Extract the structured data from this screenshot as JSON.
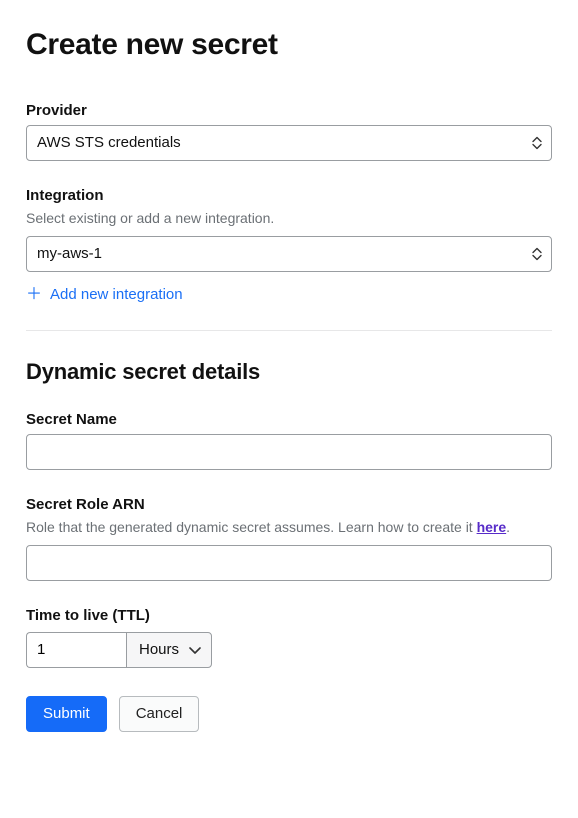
{
  "page": {
    "title": "Create new secret"
  },
  "provider": {
    "label": "Provider",
    "value": "AWS STS credentials"
  },
  "integration": {
    "label": "Integration",
    "hint": "Select existing or add a new integration.",
    "value": "my-aws-1",
    "add_label": "Add new integration"
  },
  "section": {
    "title": "Dynamic secret details"
  },
  "secret_name": {
    "label": "Secret Name",
    "value": ""
  },
  "role_arn": {
    "label": "Secret Role ARN",
    "hint_prefix": "Role that the generated dynamic secret assumes. Learn how to create it ",
    "hint_link": "here",
    "hint_suffix": ".",
    "value": ""
  },
  "ttl": {
    "label": "Time to live (TTL)",
    "value": "1",
    "unit": "Hours"
  },
  "actions": {
    "submit": "Submit",
    "cancel": "Cancel"
  }
}
